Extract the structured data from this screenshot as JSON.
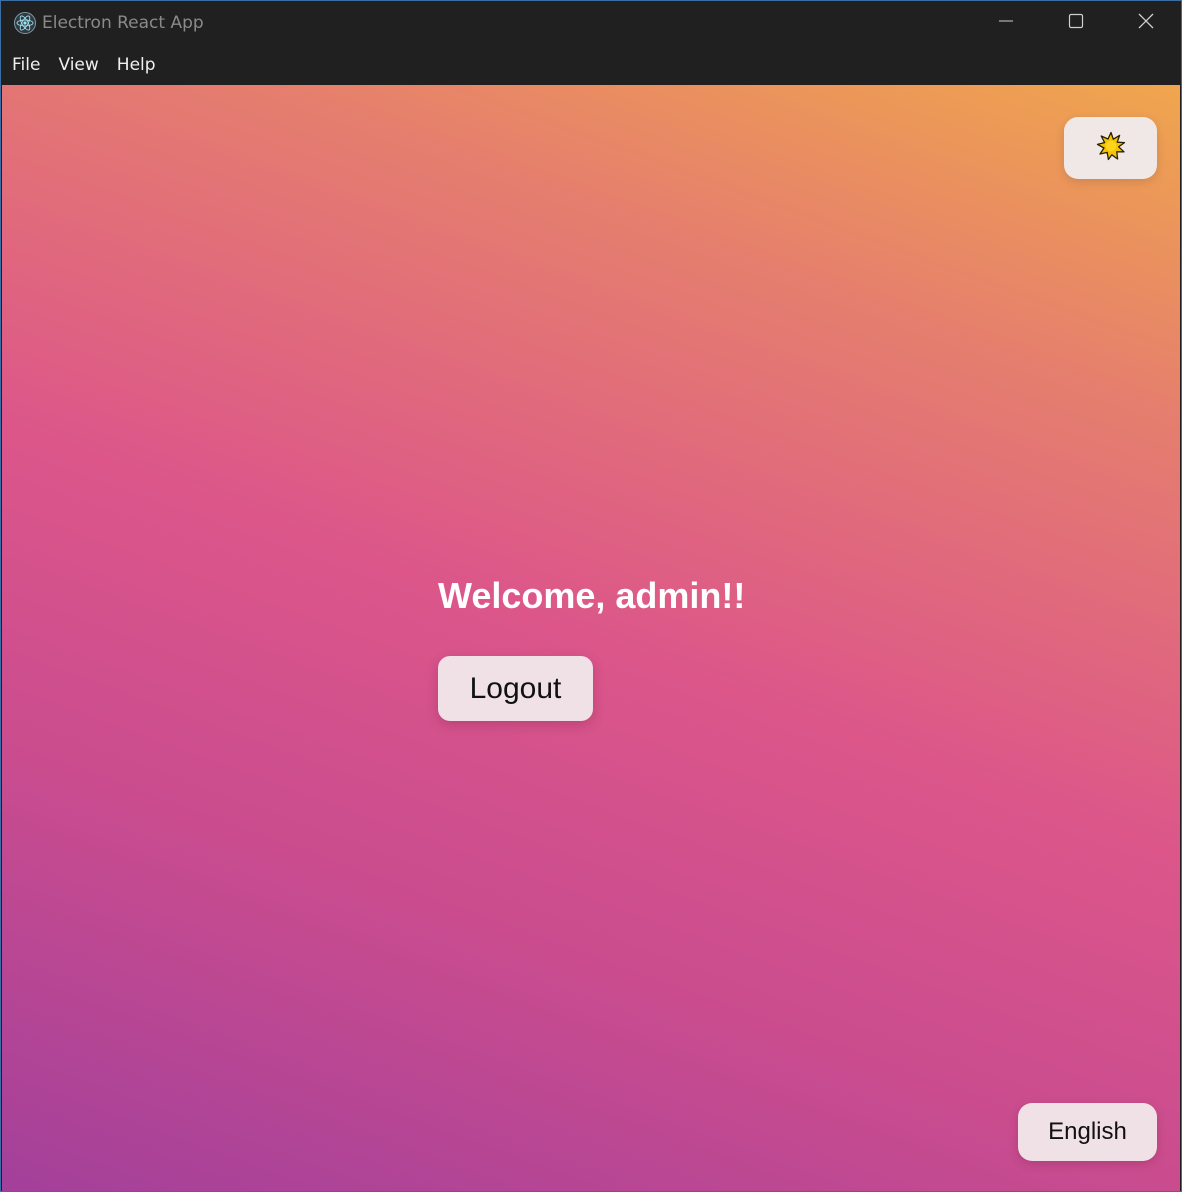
{
  "window": {
    "title": "Electron React App",
    "app_icon": "electron-atom-icon",
    "controls": {
      "minimize_icon": "minimize-icon",
      "maximize_icon": "maximize-icon",
      "close_icon": "close-icon"
    }
  },
  "menu": {
    "items": [
      {
        "label": "File"
      },
      {
        "label": "View"
      },
      {
        "label": "Help"
      }
    ]
  },
  "main": {
    "theme_toggle_icon": "sun-icon",
    "welcome_text": "Welcome, admin!!",
    "logout_label": "Logout",
    "language_label": "English"
  },
  "colors": {
    "titlebar": "#202020",
    "gradient_top": "#f0a64d",
    "gradient_mid": "#dc568a",
    "gradient_bottom": "#a3409a",
    "button_bg": "#efe1e6",
    "sun_fill": "#f5c400"
  }
}
